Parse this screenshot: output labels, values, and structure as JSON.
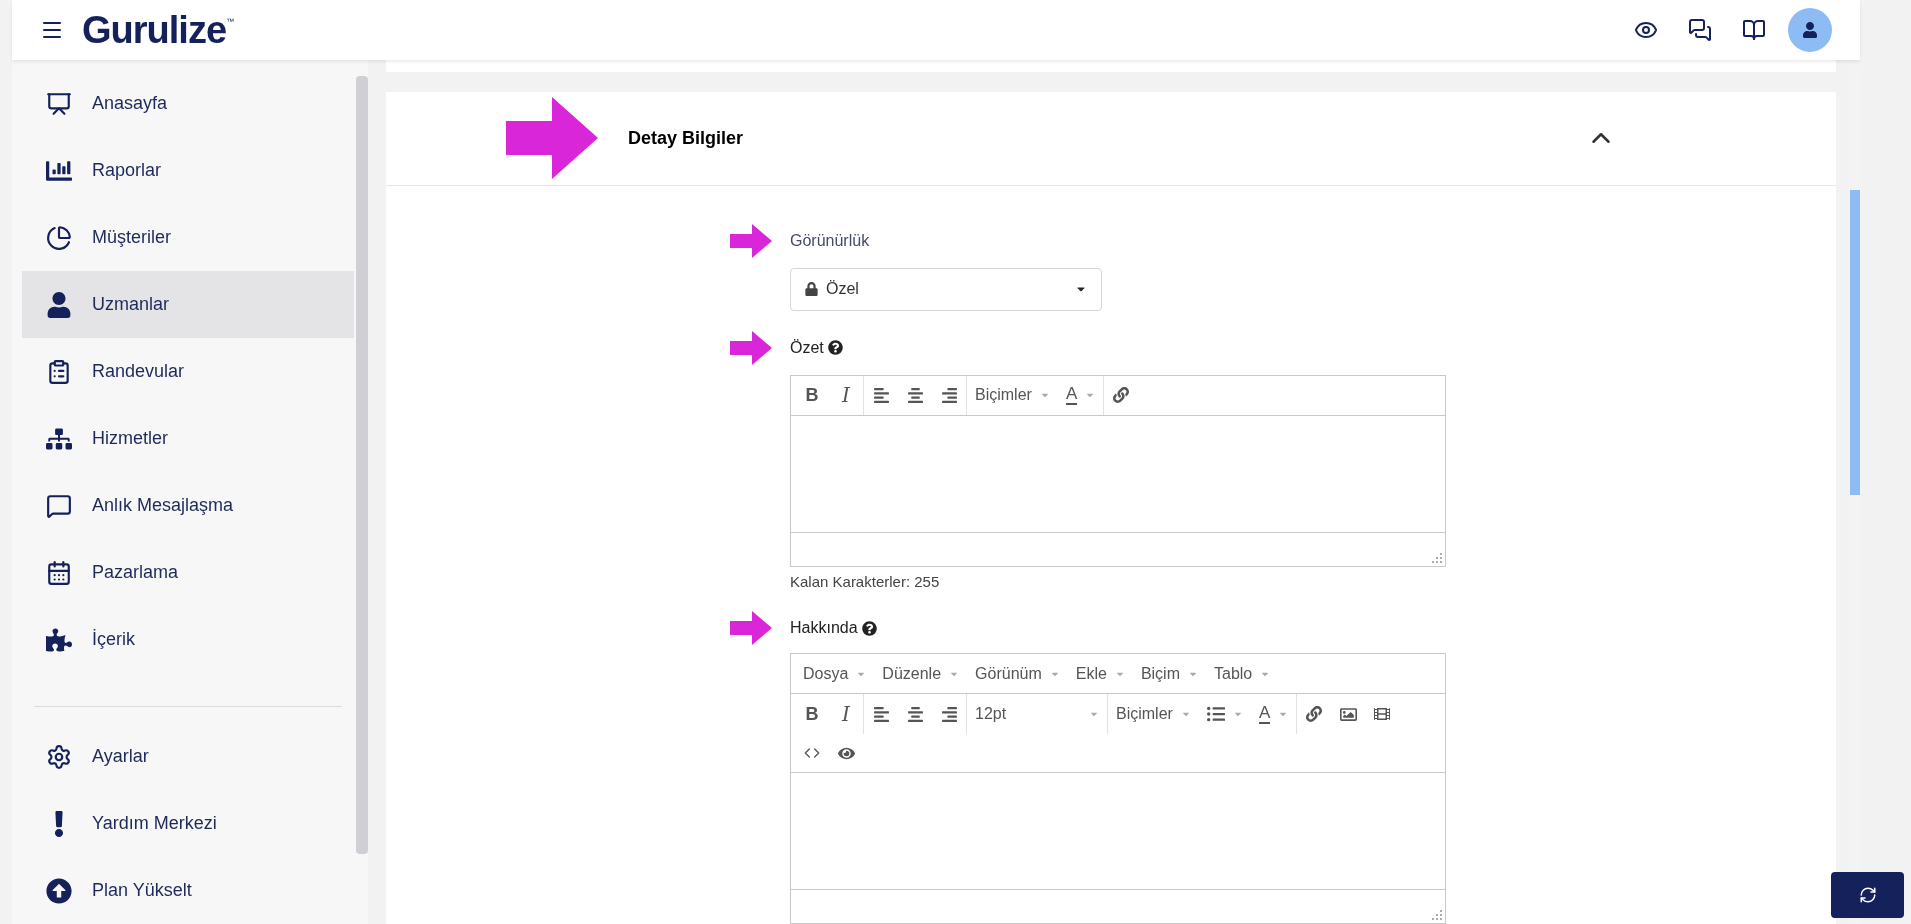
{
  "header": {
    "logo": "Gurulize",
    "trademark": "™"
  },
  "sidebar": {
    "items": [
      {
        "label": "Anasayfa",
        "selected": false
      },
      {
        "label": "Raporlar",
        "selected": false
      },
      {
        "label": "Müşteriler",
        "selected": false
      },
      {
        "label": "Uzmanlar",
        "selected": true
      },
      {
        "label": "Randevular",
        "selected": false
      },
      {
        "label": "Hizmetler",
        "selected": false
      },
      {
        "label": "Anlık Mesajlaşma",
        "selected": false
      },
      {
        "label": "Pazarlama",
        "selected": false
      },
      {
        "label": "İçerik",
        "selected": false
      }
    ],
    "bottom_items": [
      {
        "label": "Ayarlar",
        "selected": false
      },
      {
        "label": "Yardım Merkezi",
        "selected": false
      },
      {
        "label": "Plan Yükselt",
        "selected": false
      }
    ]
  },
  "section": {
    "title": "Detay Bilgiler",
    "expanded": true
  },
  "visibility": {
    "label": "Görünürlük",
    "value": "Özel"
  },
  "summary": {
    "label": "Özet",
    "bold": "B",
    "italic": "I",
    "formats": "Biçimler",
    "text_color": "A",
    "counter": "Kalan Karakterler: 255"
  },
  "about": {
    "label": "Hakkında",
    "menu": [
      "Dosya",
      "Düzenle",
      "Görünüm",
      "Ekle",
      "Biçim",
      "Tablo"
    ],
    "bold": "B",
    "italic": "I",
    "font_size": "12pt",
    "formats": "Biçimler",
    "text_color": "A"
  }
}
